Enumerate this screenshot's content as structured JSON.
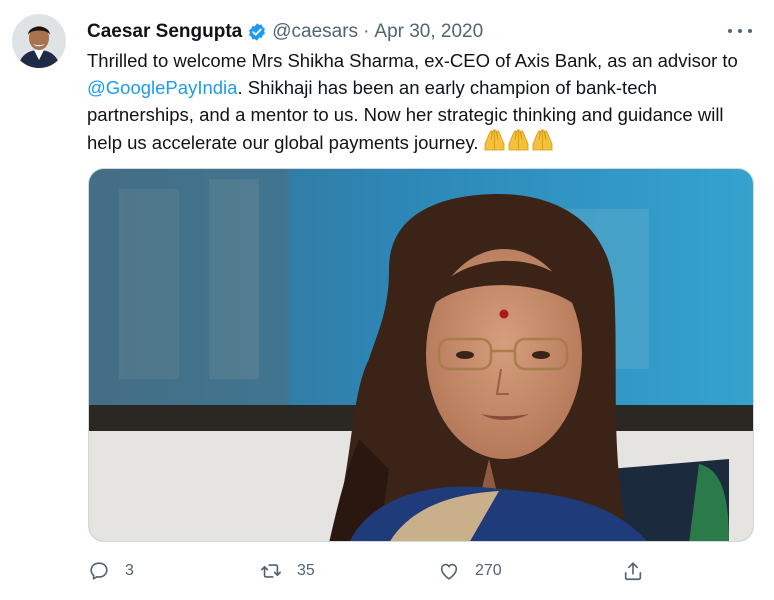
{
  "author": {
    "name": "Caesar Sengupta",
    "handle": "@caesars",
    "separator": "·",
    "date": "Apr 30, 2020",
    "verified_icon": "verified-badge-icon"
  },
  "tweet": {
    "text_before_mention": "Thrilled to welcome Mrs Shikha Sharma, ex-CEO of Axis Bank, as an advisor to ",
    "mention": "@GooglePayIndia",
    "text_after_mention": ". Shikhaji has been an early champion of bank-tech partnerships, and a mentor to us. Now her strategic thinking and guidance will help us accelerate our global payments journey.",
    "emoji": [
      "🙏",
      "🙏",
      "🙏"
    ]
  },
  "actions": {
    "replies": "3",
    "retweets": "35",
    "likes": "270"
  },
  "colors": {
    "accent": "#1d9bf0",
    "secondary_text": "#536471",
    "primary_text": "#0f1419"
  },
  "icons": {
    "more": "more-horizontal-icon",
    "reply": "reply-icon",
    "retweet": "retweet-icon",
    "like": "heart-icon",
    "share": "share-icon"
  }
}
